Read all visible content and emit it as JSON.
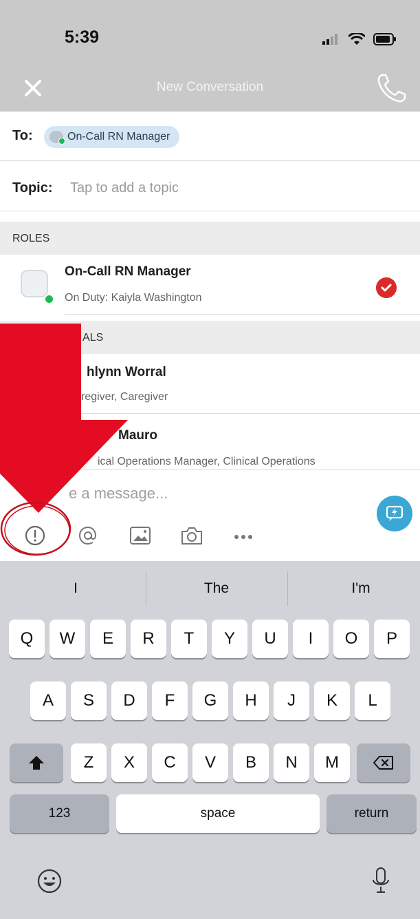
{
  "status_bar": {
    "time": "5:39"
  },
  "nav": {
    "title": "New Conversation"
  },
  "to": {
    "label": "To:",
    "chip": "On-Call RN Manager"
  },
  "topic": {
    "label": "Topic:",
    "placeholder": "Tap to add a topic"
  },
  "sections": {
    "roles": "ROLES",
    "individuals_partial": "ALS"
  },
  "roles": [
    {
      "name": "On-Call RN Manager",
      "sub": "On Duty: Kaiyla Washington",
      "selected": true
    }
  ],
  "individuals": [
    {
      "name": "hlynn Worral",
      "sub": "regiver, Caregiver"
    },
    {
      "name": "Mauro",
      "sub": "ical Operations Manager, Clinical Operations"
    }
  ],
  "composer": {
    "placeholder": "e a message..."
  },
  "toolbar": [
    "priority-icon",
    "mention-icon",
    "image-icon",
    "camera-icon",
    "more-icon"
  ],
  "keyboard": {
    "suggestions": [
      "I",
      "The",
      "I'm"
    ],
    "row1": [
      "Q",
      "W",
      "E",
      "R",
      "T",
      "Y",
      "U",
      "I",
      "O",
      "P"
    ],
    "row2": [
      "A",
      "S",
      "D",
      "F",
      "G",
      "H",
      "J",
      "K",
      "L"
    ],
    "row3": [
      "Z",
      "X",
      "C",
      "V",
      "B",
      "N",
      "M"
    ],
    "numbers_label": "123",
    "space_label": "space",
    "return_label": "return"
  },
  "colors": {
    "accent_red": "#e30c22",
    "check_red": "#d92b2b",
    "send_blue": "#3aa7d4",
    "online_green": "#1db954"
  }
}
